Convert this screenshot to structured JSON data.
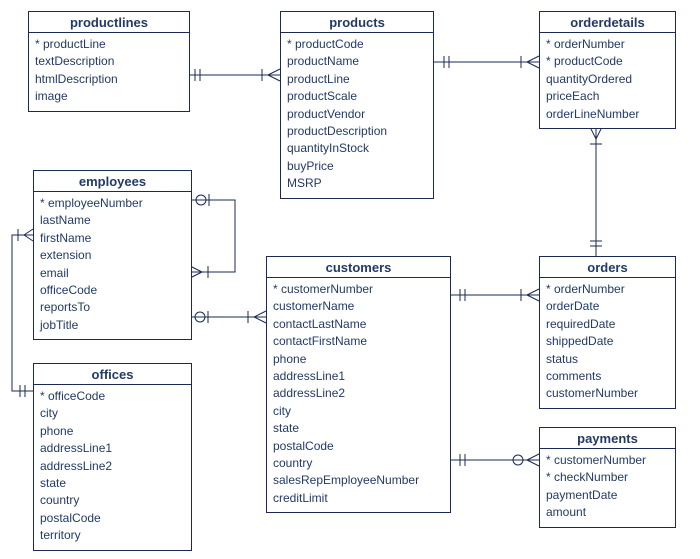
{
  "entities": {
    "productlines": {
      "title": "productlines",
      "fields": [
        "* productLine",
        "textDescription",
        "htmlDescription",
        "image"
      ]
    },
    "products": {
      "title": "products",
      "fields": [
        "* productCode",
        "productName",
        "productLine",
        "productScale",
        "productVendor",
        "productDescription",
        "quantityInStock",
        "buyPrice",
        "MSRP"
      ]
    },
    "orderdetails": {
      "title": "orderdetails",
      "fields": [
        "* orderNumber",
        "* productCode",
        "quantityOrdered",
        "priceEach",
        "orderLineNumber"
      ]
    },
    "employees": {
      "title": "employees",
      "fields": [
        "* employeeNumber",
        "lastName",
        "firstName",
        "extension",
        "email",
        "officeCode",
        "reportsTo",
        "jobTitle"
      ]
    },
    "customers": {
      "title": "customers",
      "fields": [
        "* customerNumber",
        "customerName",
        "contactLastName",
        "contactFirstName",
        "phone",
        "addressLine1",
        "addressLine2",
        "city",
        "state",
        "postalCode",
        "country",
        "salesRepEmployeeNumber",
        "creditLimit"
      ]
    },
    "orders": {
      "title": "orders",
      "fields": [
        "* orderNumber",
        "orderDate",
        "requiredDate",
        "shippedDate",
        "status",
        "comments",
        "customerNumber"
      ]
    },
    "offices": {
      "title": "offices",
      "fields": [
        "* officeCode",
        "city",
        "phone",
        "addressLine1",
        "addressLine2",
        "state",
        "country",
        "postalCode",
        "territory"
      ]
    },
    "payments": {
      "title": "payments",
      "fields": [
        "* customerNumber",
        "* checkNumber",
        "paymentDate",
        "amount"
      ]
    }
  },
  "relationships": [
    {
      "from": "productlines",
      "to": "products",
      "from_card": "one",
      "to_card": "many"
    },
    {
      "from": "products",
      "to": "orderdetails",
      "from_card": "one",
      "to_card": "many"
    },
    {
      "from": "employees",
      "to": "employees",
      "from_card": "zero-or-one",
      "to_card": "many",
      "self": true
    },
    {
      "from": "employees",
      "to": "customers",
      "from_card": "zero-or-one",
      "to_card": "many"
    },
    {
      "from": "offices",
      "to": "employees",
      "from_card": "one",
      "to_card": "many"
    },
    {
      "from": "customers",
      "to": "orders",
      "from_card": "one",
      "to_card": "many"
    },
    {
      "from": "orders",
      "to": "orderdetails",
      "from_card": "one",
      "to_card": "many"
    },
    {
      "from": "customers",
      "to": "payments",
      "from_card": "one",
      "to_card": "many"
    }
  ]
}
